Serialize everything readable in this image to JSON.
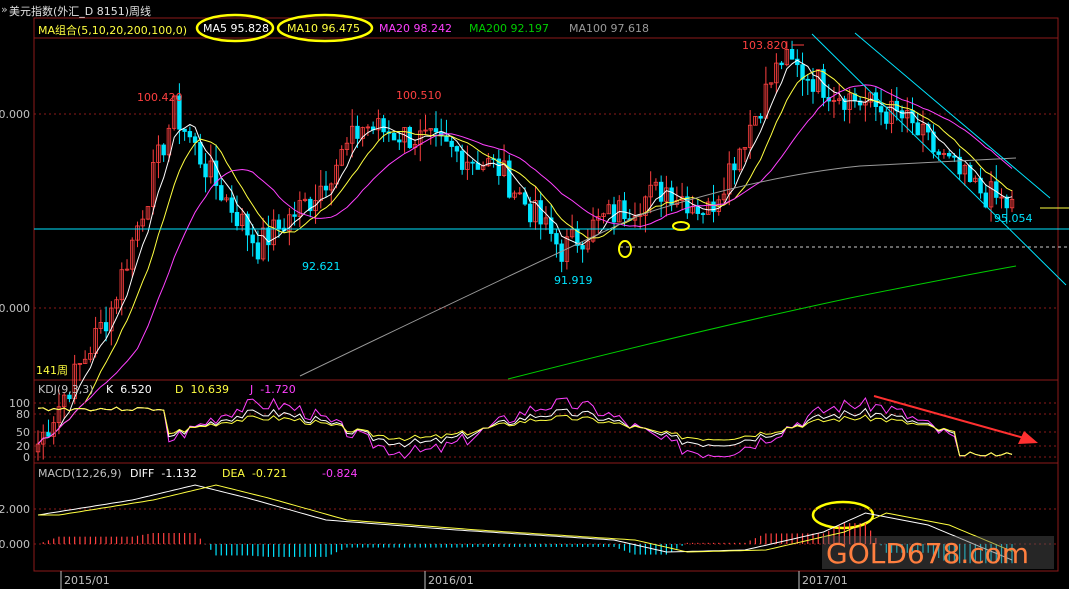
{
  "window": {
    "title": "美元指数(外汇_D 8151)周线",
    "prefix": "»"
  },
  "colors": {
    "up": "#ff4040",
    "down": "#00e5ff",
    "ma5": "#ffffff",
    "ma10": "#ffff40",
    "ma20": "#ff40ff",
    "ma200": "#00cc00",
    "ma100": "#9a9a9a",
    "k": "#ffffff",
    "d": "#ffff40",
    "j": "#ff40ff",
    "annot": "#ffff00",
    "arrow": "#ff3030",
    "grid": "#8b1a1a",
    "border": "#8b1a1a"
  },
  "ma_legend": {
    "group": "MA组合(5,10,20,200,100,0)",
    "items": [
      {
        "label": "MA5",
        "value": "95.828",
        "color": "#ffffff"
      },
      {
        "label": "MA10",
        "value": "96.475",
        "color": "#ffff40"
      },
      {
        "label": "MA20",
        "value": "98.242",
        "color": "#ff40ff"
      },
      {
        "label": "MA200",
        "value": "92.197",
        "color": "#00cc00"
      },
      {
        "label": "MA100",
        "value": "97.618",
        "color": "#9a9a9a"
      }
    ]
  },
  "price_axis": {
    "ticks": [
      "0.000",
      "0.000"
    ]
  },
  "price_annotations": [
    {
      "text": "100.420",
      "color": "#ff4040"
    },
    {
      "text": "100.510",
      "color": "#ff4040"
    },
    {
      "text": "103.820",
      "color": "#ff4040"
    },
    {
      "text": "92.621",
      "color": "#00e5ff"
    },
    {
      "text": "91.919",
      "color": "#00e5ff"
    },
    {
      "text": "95.054",
      "color": "#00e5ff"
    }
  ],
  "bars_label": "141周",
  "kdj": {
    "label": "KDJ(9,3,3)",
    "k_label": "K",
    "k_value": "6.520",
    "d_label": "D",
    "d_value": "10.639",
    "j_label": "J",
    "j_value": "-1.720",
    "ticks": [
      "100",
      "80",
      "50",
      "20",
      "0"
    ]
  },
  "macd": {
    "label": "MACD(12,26,9)",
    "diff_label": "DIFF",
    "diff_value": "-1.132",
    "dea_label": "DEA",
    "dea_value": "-0.721",
    "macd_value": "-0.824",
    "ticks": [
      "2.000",
      "0.000"
    ]
  },
  "time_axis": [
    "2015/01",
    "2016/01",
    "2017/01"
  ],
  "watermark": "GOLD678.com",
  "chart_data": {
    "type": "candlestick",
    "timeframe": "weekly",
    "price_extremes": {
      "highs": [
        100.42,
        100.51,
        103.82
      ],
      "lows": [
        92.621,
        91.919
      ],
      "last": 95.054
    },
    "moving_averages": {
      "MA5": 95.828,
      "MA10": 96.475,
      "MA20": 98.242,
      "MA200": 92.197,
      "MA100": 97.618
    },
    "kdj": {
      "K": 6.52,
      "D": 10.639,
      "J": -1.72
    },
    "macd": {
      "DIFF": -1.132,
      "DEA": -0.721,
      "MACD": -0.824
    },
    "x_labels": [
      "2015/01",
      "2016/01",
      "2017/01"
    ]
  }
}
